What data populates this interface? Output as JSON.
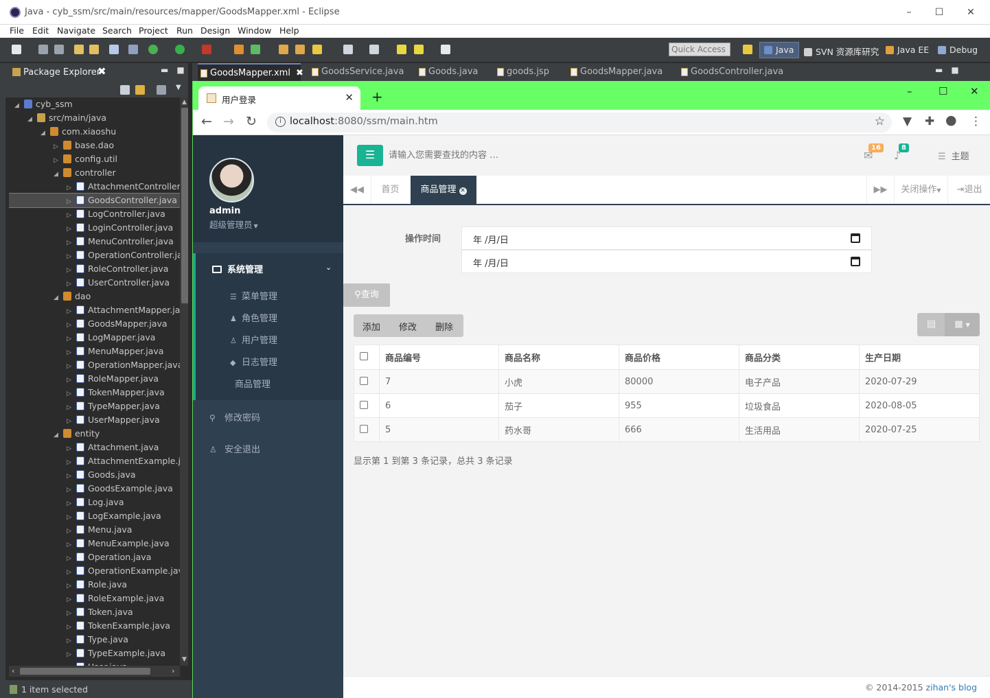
{
  "eclipse": {
    "title": "Java - cyb_ssm/src/main/resources/mapper/GoodsMapper.xml - Eclipse",
    "menu": [
      "File",
      "Edit",
      "Navigate",
      "Search",
      "Project",
      "Run",
      "Design",
      "Window",
      "Help"
    ],
    "quick_access": "Quick Access",
    "perspectives": [
      "Java",
      "SVN 资源库研究",
      "Java EE",
      "Debug"
    ],
    "status": "1 item selected",
    "window_controls": [
      "–",
      "☐",
      "✕"
    ]
  },
  "package_explorer": {
    "title": "Package Explorer",
    "tree": [
      {
        "label": "cyb_ssm",
        "icon": "project-icon",
        "twisty": "◢",
        "depth": 0
      },
      {
        "label": "src/main/java",
        "icon": "source-folder-icon",
        "twisty": "◢",
        "depth": 1
      },
      {
        "label": "com.xiaoshu",
        "icon": "package-icon",
        "twisty": "◢",
        "depth": 2
      },
      {
        "label": "base.dao",
        "icon": "package-icon",
        "twisty": "▷",
        "depth": 3
      },
      {
        "label": "config.util",
        "icon": "package-icon",
        "twisty": "▷",
        "depth": 3
      },
      {
        "label": "controller",
        "icon": "package-icon",
        "twisty": "◢",
        "depth": 3
      },
      {
        "label": "AttachmentController.java",
        "icon": "java-file-icon",
        "twisty": "▷",
        "depth": 4
      },
      {
        "label": "GoodsController.java",
        "icon": "java-file-icon",
        "twisty": "▷",
        "depth": 4,
        "selected": true
      },
      {
        "label": "LogController.java",
        "icon": "java-file-icon",
        "twisty": "▷",
        "depth": 4
      },
      {
        "label": "LoginController.java",
        "icon": "java-file-icon",
        "twisty": "▷",
        "depth": 4
      },
      {
        "label": "MenuController.java",
        "icon": "java-file-icon",
        "twisty": "▷",
        "depth": 4
      },
      {
        "label": "OperationController.java",
        "icon": "java-file-icon",
        "twisty": "▷",
        "depth": 4
      },
      {
        "label": "RoleController.java",
        "icon": "java-file-icon",
        "twisty": "▷",
        "depth": 4
      },
      {
        "label": "UserController.java",
        "icon": "java-file-icon",
        "twisty": "▷",
        "depth": 4
      },
      {
        "label": "dao",
        "icon": "package-icon",
        "twisty": "◢",
        "depth": 3
      },
      {
        "label": "AttachmentMapper.java",
        "icon": "java-file-icon",
        "twisty": "▷",
        "depth": 4
      },
      {
        "label": "GoodsMapper.java",
        "icon": "java-file-icon",
        "twisty": "▷",
        "depth": 4
      },
      {
        "label": "LogMapper.java",
        "icon": "java-file-icon",
        "twisty": "▷",
        "depth": 4
      },
      {
        "label": "MenuMapper.java",
        "icon": "java-file-icon",
        "twisty": "▷",
        "depth": 4
      },
      {
        "label": "OperationMapper.java",
        "icon": "java-file-icon",
        "twisty": "▷",
        "depth": 4
      },
      {
        "label": "RoleMapper.java",
        "icon": "java-file-icon",
        "twisty": "▷",
        "depth": 4
      },
      {
        "label": "TokenMapper.java",
        "icon": "java-file-icon",
        "twisty": "▷",
        "depth": 4
      },
      {
        "label": "TypeMapper.java",
        "icon": "java-file-icon",
        "twisty": "▷",
        "depth": 4
      },
      {
        "label": "UserMapper.java",
        "icon": "java-file-icon",
        "twisty": "▷",
        "depth": 4
      },
      {
        "label": "entity",
        "icon": "package-icon",
        "twisty": "◢",
        "depth": 3
      },
      {
        "label": "Attachment.java",
        "icon": "java-file-icon",
        "twisty": "▷",
        "depth": 4
      },
      {
        "label": "AttachmentExample.java",
        "icon": "java-file-icon",
        "twisty": "▷",
        "depth": 4
      },
      {
        "label": "Goods.java",
        "icon": "java-file-icon",
        "twisty": "▷",
        "depth": 4
      },
      {
        "label": "GoodsExample.java",
        "icon": "java-file-icon",
        "twisty": "▷",
        "depth": 4
      },
      {
        "label": "Log.java",
        "icon": "java-file-icon",
        "twisty": "▷",
        "depth": 4
      },
      {
        "label": "LogExample.java",
        "icon": "java-file-icon",
        "twisty": "▷",
        "depth": 4
      },
      {
        "label": "Menu.java",
        "icon": "java-file-icon",
        "twisty": "▷",
        "depth": 4
      },
      {
        "label": "MenuExample.java",
        "icon": "java-file-icon",
        "twisty": "▷",
        "depth": 4
      },
      {
        "label": "Operation.java",
        "icon": "java-file-icon",
        "twisty": "▷",
        "depth": 4
      },
      {
        "label": "OperationExample.java",
        "icon": "java-file-icon",
        "twisty": "▷",
        "depth": 4
      },
      {
        "label": "Role.java",
        "icon": "java-file-icon",
        "twisty": "▷",
        "depth": 4
      },
      {
        "label": "RoleExample.java",
        "icon": "java-file-icon",
        "twisty": "▷",
        "depth": 4
      },
      {
        "label": "Token.java",
        "icon": "java-file-icon",
        "twisty": "▷",
        "depth": 4
      },
      {
        "label": "TokenExample.java",
        "icon": "java-file-icon",
        "twisty": "▷",
        "depth": 4
      },
      {
        "label": "Type.java",
        "icon": "java-file-icon",
        "twisty": "▷",
        "depth": 4
      },
      {
        "label": "TypeExample.java",
        "icon": "java-file-icon",
        "twisty": "▷",
        "depth": 4
      },
      {
        "label": "User.java",
        "icon": "java-file-icon",
        "twisty": "▷",
        "depth": 4
      }
    ]
  },
  "editor_tabs": [
    {
      "label": "GoodsMapper.xml",
      "active": true
    },
    {
      "label": "GoodsService.java"
    },
    {
      "label": "Goods.java"
    },
    {
      "label": "goods.jsp"
    },
    {
      "label": "GoodsMapper.java"
    },
    {
      "label": "GoodsController.java"
    }
  ],
  "browser": {
    "tab_title": "用户登录",
    "url_host": "localhost",
    "url_rest": ":8080/ssm/main.htm"
  },
  "app": {
    "user": {
      "name": "admin",
      "role": "超级管理员"
    },
    "nav": {
      "group": "系统管理",
      "items": [
        "菜单管理",
        "角色管理",
        "用户管理",
        "日志管理",
        "商品管理"
      ],
      "change_password": "修改密码",
      "logout": "安全退出"
    },
    "search_placeholder": "请输入您需要查找的内容 …",
    "badges": {
      "mail": "16",
      "bell": "8"
    },
    "theme_label": "主题",
    "tabs": {
      "home": "首页",
      "active": "商品管理",
      "close_ops": "关闭操作",
      "exit": "退出"
    },
    "filter": {
      "label": "操作时间",
      "date_start": "年 /月/日",
      "date_end": "年 /月/日"
    },
    "query_button": "查询",
    "actions": {
      "add": "添加",
      "edit": "修改",
      "delete": "删除"
    },
    "table": {
      "columns": [
        "商品编号",
        "商品名称",
        "商品价格",
        "商品分类",
        "生产日期"
      ],
      "rows": [
        [
          "7",
          "小虎",
          "80000",
          "电子产品",
          "2020-07-29"
        ],
        [
          "6",
          "茄子",
          "955",
          "垃圾食品",
          "2020-08-05"
        ],
        [
          "5",
          "药水哥",
          "666",
          "生活用品",
          "2020-07-25"
        ]
      ]
    },
    "table_info": "显示第 1 到第 3 条记录，总共 3 条记录",
    "footer": {
      "copyright": "© 2014-2015 ",
      "author": "zihan's blog"
    }
  },
  "colors": {
    "accent": "#1ab394",
    "sidebar": "#2f4050",
    "chrome_frame": "#68ff66",
    "badge_mail": "#f8ac59",
    "badge_bell": "#1ab394"
  }
}
